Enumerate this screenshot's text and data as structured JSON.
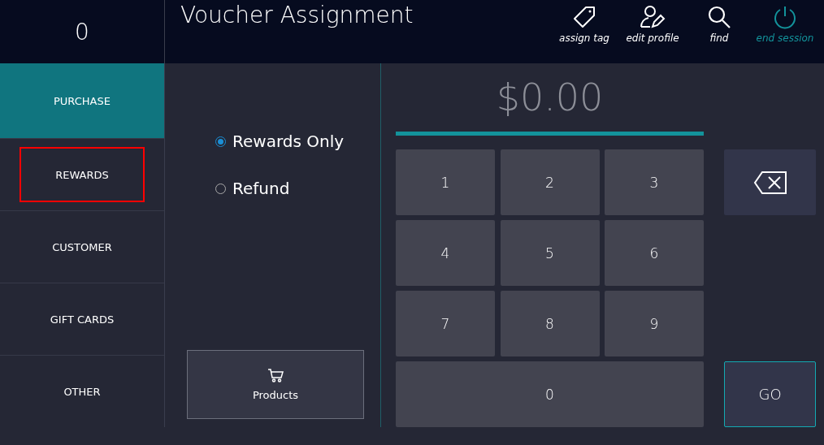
{
  "counter": "0",
  "title": "Voucher Assignment",
  "actions": [
    {
      "label": "assign tag",
      "kind": "tag"
    },
    {
      "label": "edit profile",
      "kind": "profile"
    },
    {
      "label": "find",
      "kind": "search"
    },
    {
      "label": "end session",
      "kind": "exit"
    }
  ],
  "sidebar": {
    "items": [
      {
        "label": "PURCHASE",
        "selected": true,
        "highlighted": false
      },
      {
        "label": "REWARDS",
        "selected": false,
        "highlighted": true
      },
      {
        "label": "CUSTOMER",
        "selected": false,
        "highlighted": false
      },
      {
        "label": "GIFT CARDS",
        "selected": false,
        "highlighted": false
      },
      {
        "label": "OTHER",
        "selected": false,
        "highlighted": false
      }
    ]
  },
  "options": [
    {
      "label": "Rewards Only",
      "selected": true
    },
    {
      "label": "Refund",
      "selected": false
    }
  ],
  "products_button": {
    "label": "Products"
  },
  "amount": "$0.00",
  "keys": [
    {
      "label": "1",
      "kind": "digit"
    },
    {
      "label": "2",
      "kind": "digit"
    },
    {
      "label": "3",
      "kind": "digit"
    },
    {
      "kind": "backspace"
    },
    {
      "label": "4",
      "kind": "digit"
    },
    {
      "label": "5",
      "kind": "digit"
    },
    {
      "label": "6",
      "kind": "digit"
    },
    {
      "label": "7",
      "kind": "digit"
    },
    {
      "label": "8",
      "kind": "digit"
    },
    {
      "label": "9",
      "kind": "digit"
    },
    {
      "label": "0",
      "kind": "wide"
    },
    {
      "label": "GO",
      "kind": "go"
    }
  ]
}
